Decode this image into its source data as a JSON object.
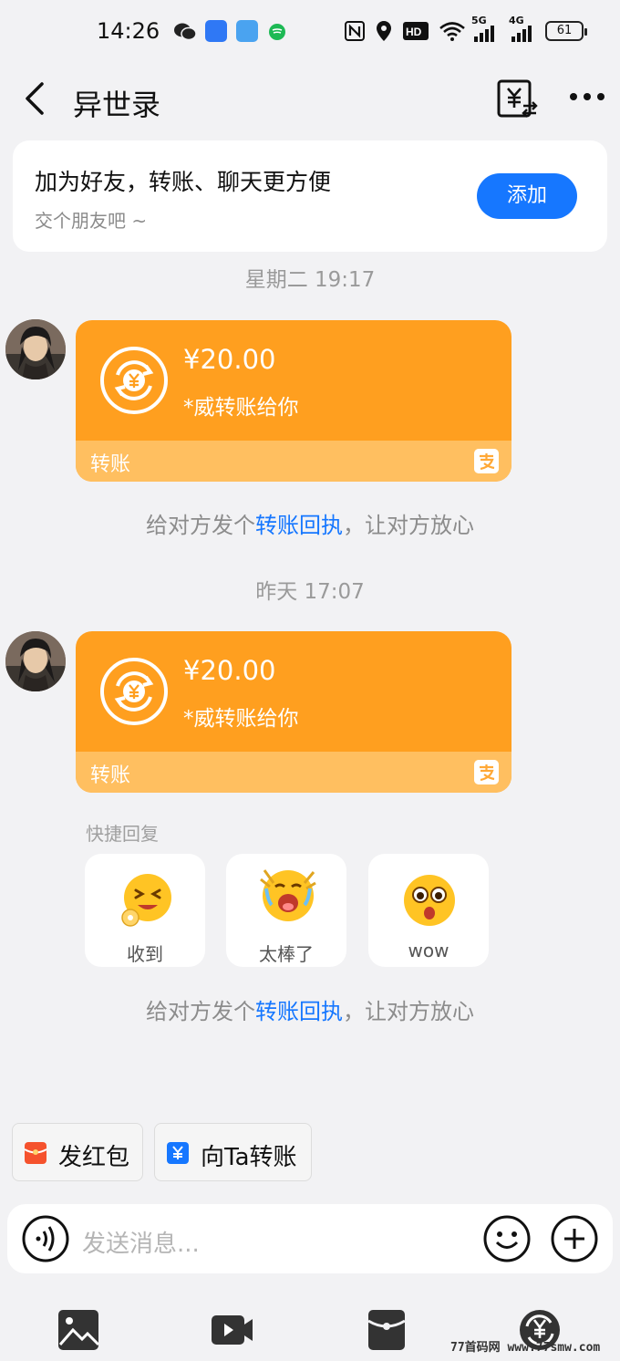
{
  "status_bar": {
    "time": "14:26",
    "network_labels": [
      "5G",
      "4G"
    ],
    "battery": "61"
  },
  "header": {
    "title": "异世录"
  },
  "add_friend_card": {
    "title": "加为好友，转账、聊天更方便",
    "subtitle": "交个朋友吧 ~",
    "button_label": "添加"
  },
  "messages": [
    {
      "timestamp": "星期二 19:17",
      "amount": "¥20.00",
      "description": "*威转账给你",
      "label": "转账",
      "hint_prefix": "给对方发个",
      "hint_link": "转账回执",
      "hint_suffix": "，让对方放心"
    },
    {
      "timestamp": "昨天 17:07",
      "amount": "¥20.00",
      "description": "*威转账给你",
      "label": "转账",
      "hint_prefix": "给对方发个",
      "hint_link": "转账回执",
      "hint_suffix": "，让对方放心"
    }
  ],
  "quick_reply": {
    "title": "快捷回复",
    "items": [
      {
        "label": "收到",
        "icon": "ok-hand-emoji-icon"
      },
      {
        "label": "太棒了",
        "icon": "cheering-emoji-icon"
      },
      {
        "label": "wow",
        "icon": "shocked-emoji-icon"
      }
    ]
  },
  "action_chips": {
    "red_packet": "发红包",
    "transfer": "向Ta转账"
  },
  "input": {
    "placeholder": "发送消息..."
  },
  "watermark": "77首码网 www.77smw.com",
  "colors": {
    "accent": "#1677ff",
    "transfer_card": "#ff9f1f",
    "transfer_footer": "#ffbf60",
    "background": "#f2f2f4"
  }
}
